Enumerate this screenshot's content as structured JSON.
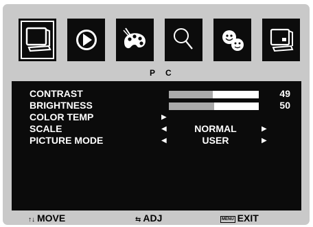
{
  "icons": [
    {
      "name": "monitor-icon",
      "selected": true
    },
    {
      "name": "play-icon",
      "selected": false
    },
    {
      "name": "palette-icon",
      "selected": false
    },
    {
      "name": "magnifier-icon",
      "selected": false
    },
    {
      "name": "faces-icon",
      "selected": false
    },
    {
      "name": "screen-config-icon",
      "selected": false
    }
  ],
  "menu": {
    "title_left": "P",
    "title_right": "C"
  },
  "settings": {
    "contrast": {
      "label": "CONTRAST",
      "value": "49",
      "level": 0.49
    },
    "brightness": {
      "label": "BRIGHTNESS",
      "value": "50",
      "level": 0.5
    },
    "color_temp": {
      "label": "COLOR TEMP",
      "arrow": "▶"
    },
    "scale": {
      "label": "SCALE",
      "value": "NORMAL",
      "arrow_left": "◀",
      "arrow_right": "▶"
    },
    "picture_mode": {
      "label": "PICTURE MODE",
      "value": "USER",
      "arrow_left": "◀",
      "arrow_right": "▶"
    }
  },
  "footer": {
    "move_glyph": "↑↓",
    "move_label": "MOVE",
    "adjust_glyph": "⇆",
    "adjust_label": "ADJ",
    "menu_key": "MENU",
    "exit_label": "EXIT"
  },
  "colors": {
    "panel": "#0b0b0b",
    "bar_track": "#ffffff",
    "bar_fill": "#a9a9a9",
    "frame": "#c9c9c9"
  }
}
